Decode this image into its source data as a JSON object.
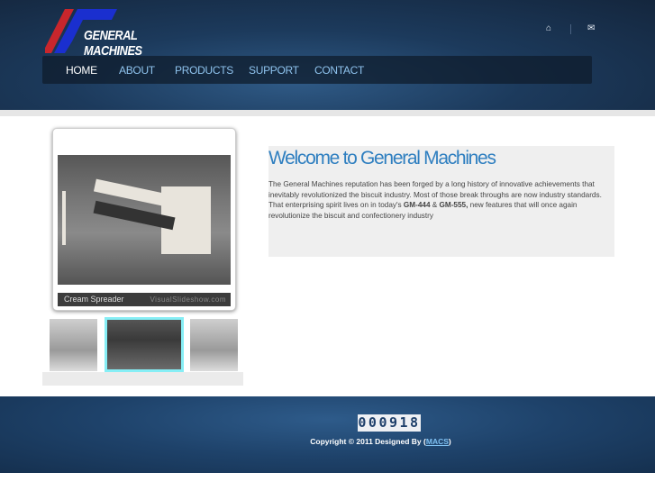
{
  "header": {
    "logo_text": "GENERAL MACHINES",
    "icons": [
      "home-icon",
      "mail-icon"
    ]
  },
  "nav": {
    "items": [
      "HOME",
      "ABOUT",
      "PRODUCTS",
      "SUPPORT",
      "CONTACT"
    ],
    "active": "HOME"
  },
  "slideshow": {
    "caption": "Cream Spreader",
    "watermark": "VisualSlideshow.com",
    "thumbnail_count": 3,
    "selected_thumbnail": 2
  },
  "welcome": {
    "title": "Welcome to General Machines",
    "text_1": "The General Machines reputation has been forged by a long history of innovative achievements that inevitably revolutionized the biscuit industry. Most of those break throughs are now industry standards. That enterprising spirit lives on in today's ",
    "bold_1": "GM-444",
    "amp": " & ",
    "bold_2": "GM-555,",
    "text_2": " new features that will once again revolutionize the biscuit and confectionery industry"
  },
  "footer": {
    "counter": "000918",
    "copyright": "Copyright © 2011 Designed By (",
    "link": "MACS",
    "close": ")"
  },
  "colors": {
    "accent": "#2f7fc0",
    "header_bg": "#1c3a5c",
    "selected_thumb": "#86eef5"
  }
}
